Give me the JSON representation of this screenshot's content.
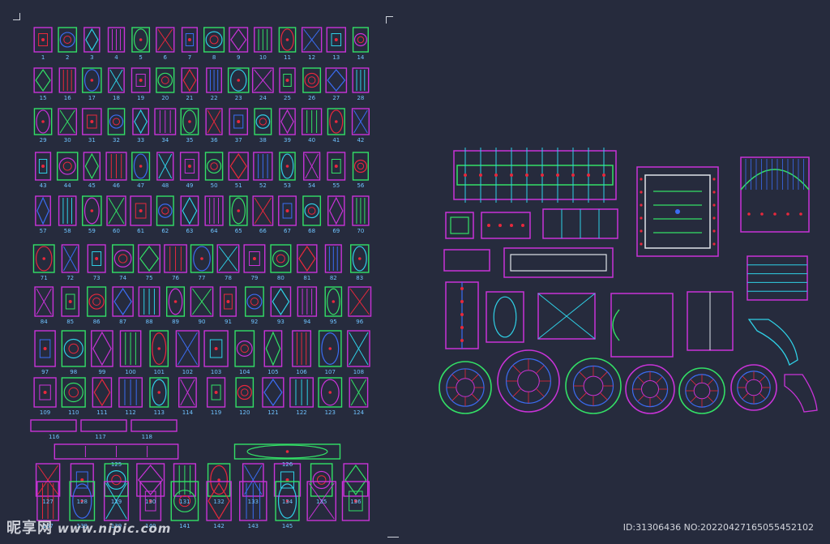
{
  "watermark": {
    "brand": "昵享网",
    "site": "www.nipic.com",
    "id_text": "ID:31306436 NO:20220427165055452102"
  },
  "colors": {
    "background": "#262b3d",
    "magenta": "#c933d8",
    "green": "#33e066",
    "red": "#e8283c",
    "blue": "#3b6cf2",
    "cyan": "#2fd0e6",
    "label": "#6fc3ff",
    "white": "#dfe3ea"
  },
  "catalog": {
    "labels": [
      "1",
      "2",
      "3",
      "4",
      "5",
      "6",
      "7",
      "8",
      "9",
      "10",
      "11",
      "12",
      "13",
      "14",
      "15",
      "16",
      "17",
      "18",
      "19",
      "20",
      "21",
      "22",
      "23",
      "24",
      "25",
      "26",
      "27",
      "28",
      "29",
      "30",
      "31",
      "32",
      "33",
      "34",
      "35",
      "36",
      "37",
      "38",
      "39",
      "40",
      "41",
      "42",
      "43",
      "44",
      "45",
      "46",
      "47",
      "48",
      "49",
      "50",
      "51",
      "52",
      "53",
      "54",
      "55",
      "56",
      "57",
      "58",
      "59",
      "60",
      "61",
      "62",
      "63",
      "64",
      "65",
      "66",
      "67",
      "68",
      "69",
      "70",
      "71",
      "72",
      "73",
      "74",
      "75",
      "76",
      "77",
      "78",
      "79",
      "80",
      "81",
      "82",
      "83",
      "84",
      "85",
      "86",
      "87",
      "88",
      "89",
      "90",
      "91",
      "92",
      "93",
      "94",
      "95",
      "96",
      "97",
      "98",
      "99",
      "100",
      "101",
      "102",
      "103",
      "104",
      "105",
      "106",
      "107",
      "108",
      "109",
      "110",
      "111",
      "112",
      "113",
      "114",
      "119",
      "120",
      "121",
      "122",
      "123",
      "124",
      "116",
      "117",
      "118",
      "125",
      "126",
      "127",
      "128",
      "129",
      "130",
      "131",
      "132",
      "133",
      "134",
      "135",
      "136",
      "137",
      "138",
      "139",
      "140",
      "141",
      "142",
      "143",
      "145"
    ]
  }
}
